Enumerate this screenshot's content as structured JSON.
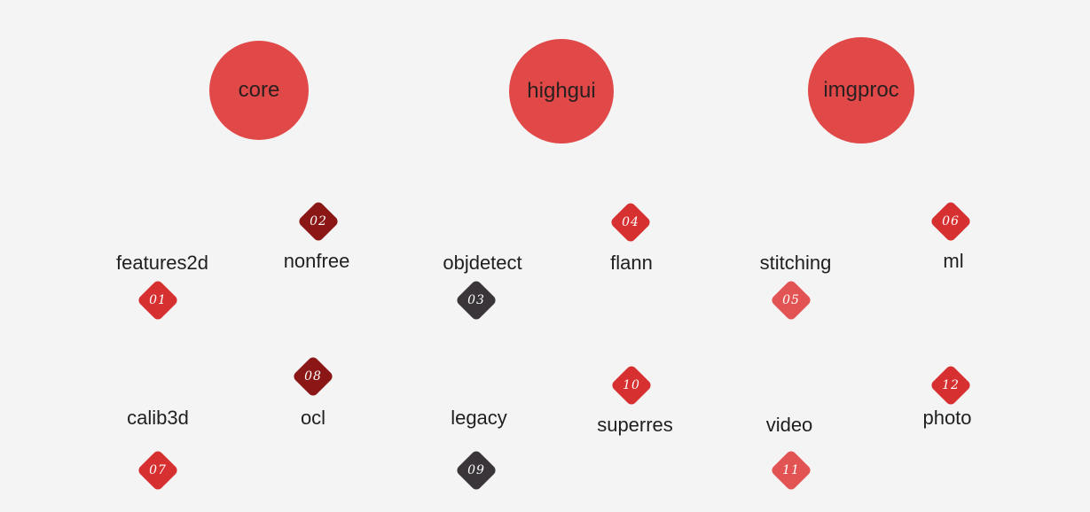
{
  "colors": {
    "background": "#f4f4f4",
    "circle": "#e14848",
    "badge_red": "#d63031",
    "badge_darkred": "#8a1616",
    "badge_dark": "#3a3538",
    "badge_light": "#e25454"
  },
  "core_modules": [
    {
      "label": "core"
    },
    {
      "label": "highgui"
    },
    {
      "label": "imgproc"
    }
  ],
  "modules": [
    {
      "num": "01",
      "label": "features2d",
      "color": "#d63031"
    },
    {
      "num": "02",
      "label": "nonfree",
      "color": "#8a1616"
    },
    {
      "num": "03",
      "label": "objdetect",
      "color": "#3a3538"
    },
    {
      "num": "04",
      "label": "flann",
      "color": "#d63031"
    },
    {
      "num": "05",
      "label": "stitching",
      "color": "#e25454"
    },
    {
      "num": "06",
      "label": "ml",
      "color": "#d63031"
    },
    {
      "num": "07",
      "label": "calib3d",
      "color": "#d63031"
    },
    {
      "num": "08",
      "label": "ocl",
      "color": "#8a1616"
    },
    {
      "num": "09",
      "label": "legacy",
      "color": "#3a3538"
    },
    {
      "num": "10",
      "label": "superres",
      "color": "#d63031"
    },
    {
      "num": "11",
      "label": "video",
      "color": "#e25454"
    },
    {
      "num": "12",
      "label": "photo",
      "color": "#d63031"
    }
  ]
}
